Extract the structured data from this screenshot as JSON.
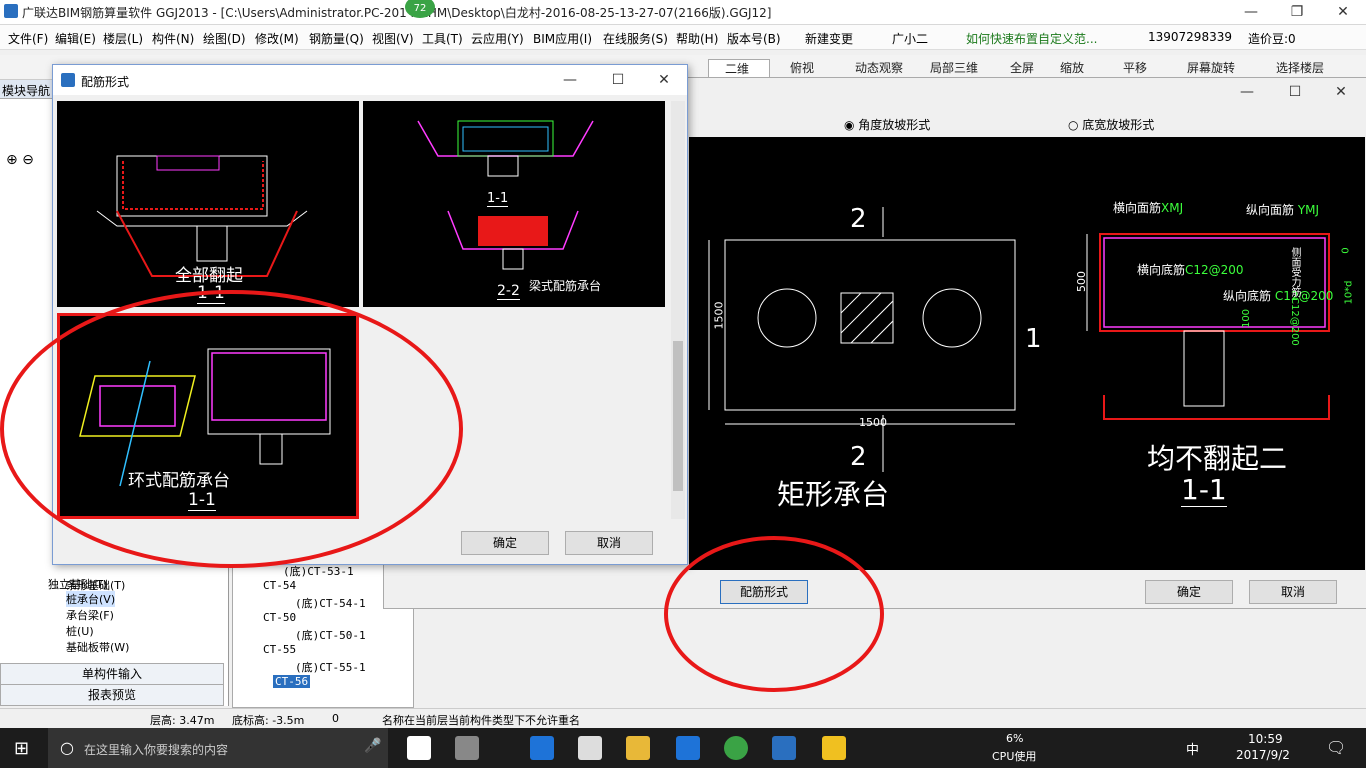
{
  "app": {
    "title": "广联达BIM钢筋算量软件 GGJ2013 - [C:\\Users\\Administrator.PC-201     NRHM\\Desktop\\白龙村-2016-08-25-13-27-07(2166版).GGJ12]",
    "badge": "72"
  },
  "menu": [
    "文件(F)",
    "编辑(E)",
    "楼层(L)",
    "构件(N)",
    "绘图(D)",
    "修改(M)",
    "钢筋量(Q)",
    "视图(V)",
    "工具(T)",
    "云应用(Y)",
    "BIM应用(I)",
    "在线服务(S)",
    "帮助(H)",
    "版本号(B)",
    "新建变更",
    "广小二",
    "如何快速布置自定义范...",
    "13907298339",
    "造价豆:0"
  ],
  "toolbar": [
    "二维",
    "俯视",
    "动态观察",
    "局部三维",
    "全屏",
    "缩放",
    "平移",
    "屏幕旋转",
    "选择楼层"
  ],
  "leftnav": {
    "header": "模块导航",
    "items": [
      "独立基础(T)",
      "条形基础(T)",
      "桩承台(V)",
      "承台梁(F)",
      "桩(U)",
      "基础板带(W)"
    ],
    "btn_single": "单构件输入",
    "btn_report": "报表预览"
  },
  "tree": {
    "items": [
      "(底)CT-53-1",
      "CT-54",
      "(底)CT-54-1",
      "CT-50",
      "(底)CT-50-1",
      "CT-55",
      "(底)CT-55-1",
      "CT-56"
    ]
  },
  "prop": {
    "radio1": "角度放坡形式",
    "radio2": "底宽放坡形式",
    "left_drawing": {
      "top_num": "2",
      "dim_w": "1500",
      "dim_h": "1500",
      "side": "1",
      "bottom_num": "2",
      "caption": "矩形承台"
    },
    "right_drawing": {
      "xmj": "横向面筋",
      "xmj_code": "XMJ",
      "ymj": "纵向面筋",
      "ymj_code": "YMJ",
      "xdj": "横向底筋",
      "xdj_code": "C12@200",
      "ydj": "纵向底筋",
      "ydj_code": "C12@200",
      "h": "500",
      "side_label": "侧面受力筋",
      "side_code": "C12@200",
      "dim0": "0",
      "dim1": "10*d",
      "dim2": "100",
      "caption": "均不翻起二",
      "section": "1-1"
    },
    "btn_form": "配筋形式",
    "btn_ok": "确定",
    "btn_cancel": "取消"
  },
  "dialog": {
    "title": "配筋形式",
    "cells": [
      {
        "caption": "全部翻起",
        "section": "1-1"
      },
      {
        "caption": "梁式配筋承台",
        "section": "2-2",
        "sub": "1-1"
      },
      {
        "caption": "环式配筋承台",
        "section": "1-1"
      }
    ],
    "ok": "确定",
    "cancel": "取消"
  },
  "status": {
    "floor_h": "层高: 3.47m",
    "bottom_h": "底标高: -3.5m",
    "zero": "0",
    "msg": "名称在当前层当前构件类型下不允许重名"
  },
  "taskbar": {
    "search": "在这里输入你要搜索的内容",
    "cpu": "6%",
    "cpu_label": "CPU使用",
    "ime": "中",
    "time": "10:59",
    "date": "2017/9/2"
  },
  "colors": {
    "accent": "#2a6fbf",
    "highlight": "#e81818",
    "drawing_bg": "#000000"
  }
}
